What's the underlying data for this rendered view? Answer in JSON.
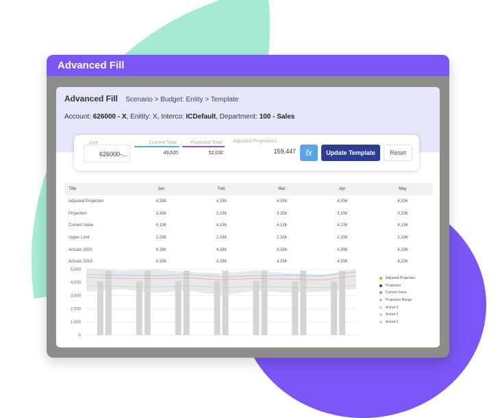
{
  "window": {
    "title": "Advanced Fill"
  },
  "header": {
    "title": "Advanced Fill",
    "breadcrumb": "Scenario > Budget: Entity > Template",
    "account_label": "Account:",
    "account_value": "626000 - X",
    "entity_label": ", Enitity: X, Interco:",
    "interco_value": "ICDefault",
    "department_label": ", Department:",
    "department_value": "100 - Sales"
  },
  "toolbar": {
    "line_label": "Line",
    "line_value": "626000-...",
    "current_total_label": "Current Total",
    "current_total_value": "43,620",
    "projected_total_label": "Projected Total",
    "projected_total_value": "52,032",
    "adjusted_label": "Adjusted Projections",
    "adjusted_value": "159,447",
    "fx_label": "fx",
    "update_label": "Update Template",
    "reset_label": "Reset"
  },
  "table": {
    "headers": [
      "Title",
      "Jan",
      "Feb",
      "Mar",
      "Apr",
      "May"
    ],
    "rows": [
      [
        "Adjusted Projection",
        "4,336",
        "4,336",
        "4,336",
        "4,336",
        "4,336"
      ],
      [
        "Projection",
        "3,336",
        "3,336",
        "3,336",
        "3,336",
        "3,336"
      ],
      [
        "Current Value",
        "4,136",
        "4,136",
        "4,136",
        "4,136",
        "4,136"
      ],
      [
        "Upper Limit",
        "2,336",
        "2,336",
        "2,336",
        "2,336",
        "2,336"
      ],
      [
        "Actuals 2020",
        "4,336",
        "4,336",
        "4,336",
        "4,336",
        "4,336"
      ],
      [
        "Actuals 2019",
        "4,336",
        "4,336",
        "4,336",
        "4,336",
        "4,336"
      ]
    ]
  },
  "legend": {
    "items": [
      {
        "label": "Adjusted Projection",
        "color": "#e0a030"
      },
      {
        "label": "Projection",
        "color": "#2c3e94"
      },
      {
        "label": "Current Value",
        "color": "#5aa5e8"
      },
      {
        "label": "Projection Range",
        "color": "#bbbbbb"
      },
      {
        "label": "Actual X",
        "color": "#cccccc"
      },
      {
        "label": "Actual X",
        "color": "#cccccc"
      },
      {
        "label": "Actual X",
        "color": "#cccccc"
      }
    ]
  },
  "chart_data": {
    "type": "bar",
    "y_ticks": [
      "5,000",
      "4,000",
      "3,000",
      "2,000",
      "1,000",
      "0"
    ],
    "ylim": [
      0,
      5000
    ],
    "bars": [
      4100,
      4900,
      4100,
      4900,
      4100,
      4900,
      4100,
      4900,
      4100,
      4900,
      4100,
      4900,
      4100,
      4900
    ],
    "range_upper": [
      5100,
      4900,
      5000,
      4800,
      4700,
      4900,
      4700,
      4600,
      5000
    ],
    "range_lower": [
      3300,
      3500,
      3200,
      3400,
      3000,
      3400,
      3200,
      3300,
      3500
    ],
    "line_red": [
      4400,
      4300,
      4300,
      4350,
      4200,
      4300,
      4250,
      4200,
      4500
    ],
    "line_blue": [
      4600,
      4550,
      4500,
      4600,
      4450,
      4500,
      4550,
      4500,
      4800
    ],
    "line_lower": [
      3800,
      3700,
      3650,
      3750,
      3600,
      3700,
      3650,
      3600,
      3800
    ]
  }
}
